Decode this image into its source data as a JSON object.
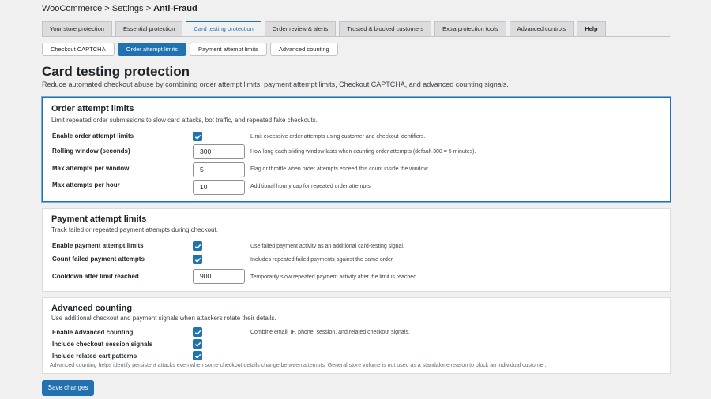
{
  "breadcrumb": {
    "part1": "WooCommerce",
    "sep1": ">",
    "part2": "Settings",
    "sep2": ">",
    "current": "Anti-Fraud"
  },
  "tabs": [
    {
      "label": "Your store protection"
    },
    {
      "label": "Essential protection"
    },
    {
      "label": "Card testing protection",
      "active": true
    },
    {
      "label": "Order review & alerts"
    },
    {
      "label": "Trusted & blocked customers"
    },
    {
      "label": "Extra protection tools"
    },
    {
      "label": "Advanced controls"
    },
    {
      "label": "Help"
    }
  ],
  "subtabs": [
    {
      "label": "Checkout CAPTCHA"
    },
    {
      "label": "Order attempt limits",
      "active": true
    },
    {
      "label": "Payment attempt limits"
    },
    {
      "label": "Advanced counting"
    }
  ],
  "page": {
    "title": "Card testing protection",
    "description": "Reduce automated checkout abuse by combining order attempt limits, payment attempt limits, Checkout CAPTCHA, and advanced counting signals."
  },
  "order_limits": {
    "title": "Order attempt limits",
    "description": "Limit repeated order submissions to slow card attacks, bot traffic, and repeated fake checkouts.",
    "enable": {
      "label": "Enable order attempt limits",
      "checked": true,
      "help": "Limit excessive order attempts using customer and checkout identifiers."
    },
    "window": {
      "label": "Rolling window (seconds)",
      "value": "300",
      "help": "How long each sliding window lasts when counting order attempts (default 300 = 5 minutes)."
    },
    "max_window": {
      "label": "Max attempts per window",
      "value": "5",
      "help": "Flag or throttle when order attempts exceed this count inside the window."
    },
    "max_hour": {
      "label": "Max attempts per hour",
      "value": "10",
      "help": "Additional hourly cap for repeated order attempts."
    }
  },
  "payment_limits": {
    "title": "Payment attempt limits",
    "description": "Track failed or repeated payment attempts during checkout.",
    "enable": {
      "label": "Enable payment attempt limits",
      "checked": true,
      "help": "Use failed payment activity as an additional card-testing signal."
    },
    "count_failed": {
      "label": "Count failed payment attempts",
      "checked": true,
      "help": "Includes repeated failed payments against the same order."
    },
    "cooldown": {
      "label": "Cooldown after limit reached",
      "value": "900",
      "help": "Temporarily slow repeated payment activity after the limit is reached."
    }
  },
  "advanced": {
    "title": "Advanced counting",
    "description": "Use additional checkout and payment signals when attackers rotate their details.",
    "enable": {
      "label": "Enable Advanced counting",
      "checked": true,
      "help": "Combine email, IP, phone, session, and related checkout signals."
    },
    "session": {
      "label": "Include checkout session signals",
      "checked": true
    },
    "cart": {
      "label": "Include related cart patterns",
      "checked": true
    },
    "note": "Advanced counting helps identify persistent attacks even when some checkout details change between attempts. General store volume is not used as a standalone reason to block an individual customer."
  },
  "save_label": "Save changes",
  "colors": {
    "accent": "#2271b1",
    "background": "#f0f0f1"
  }
}
